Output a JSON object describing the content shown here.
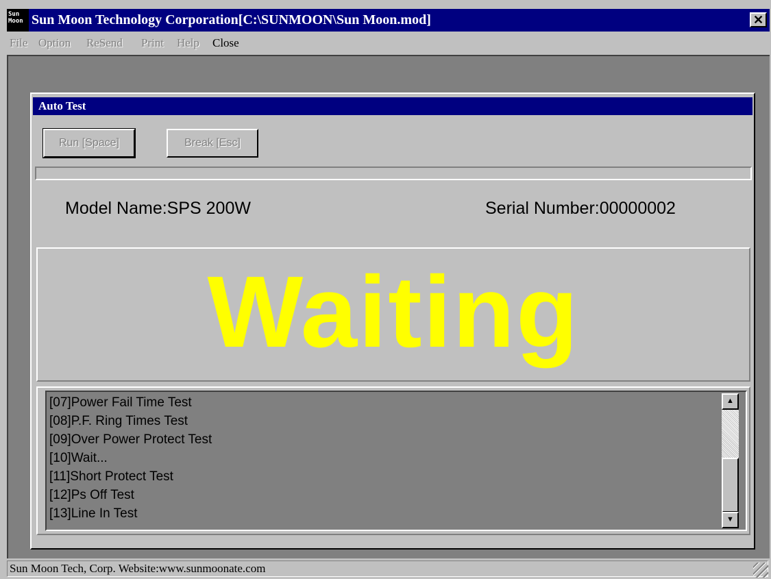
{
  "window": {
    "title": "Sun Moon Technology Corporation[C:\\SUNMOON\\Sun Moon.mod]",
    "icon_text": "Sun Moon",
    "close_symbol": "✕"
  },
  "menu": [
    {
      "label": "File",
      "enabled": false
    },
    {
      "label": "Option",
      "enabled": false
    },
    {
      "label": "ReSend",
      "enabled": false
    },
    {
      "label": "Print",
      "enabled": false
    },
    {
      "label": "Help",
      "enabled": false
    },
    {
      "label": "Close",
      "enabled": true
    }
  ],
  "autotest": {
    "title": "Auto Test",
    "run_label": "Run [Space]",
    "break_label": "Break [Esc]",
    "model_name": "Model Name:SPS 200W",
    "serial_number": "Serial Number:00000002",
    "status": "Waiting",
    "status_color": "#ffff00",
    "progress": 0,
    "log": [
      "[07]Power Fail Time Test",
      "[08]P.F. Ring Times Test",
      "[09]Over Power Protect Test",
      "[10]Wait...",
      "[11]Short Protect Test",
      "[12]Ps Off Test",
      "[13]Line In Test"
    ],
    "scroll_up_icon": "▲",
    "scroll_down_icon": "▼"
  },
  "statusbar": {
    "text": "Sun Moon Tech, Corp. Website:www.sunmoonate.com"
  },
  "colors": {
    "title_bar": "#000080",
    "face": "#c0c0c0",
    "workspace": "#808080"
  }
}
